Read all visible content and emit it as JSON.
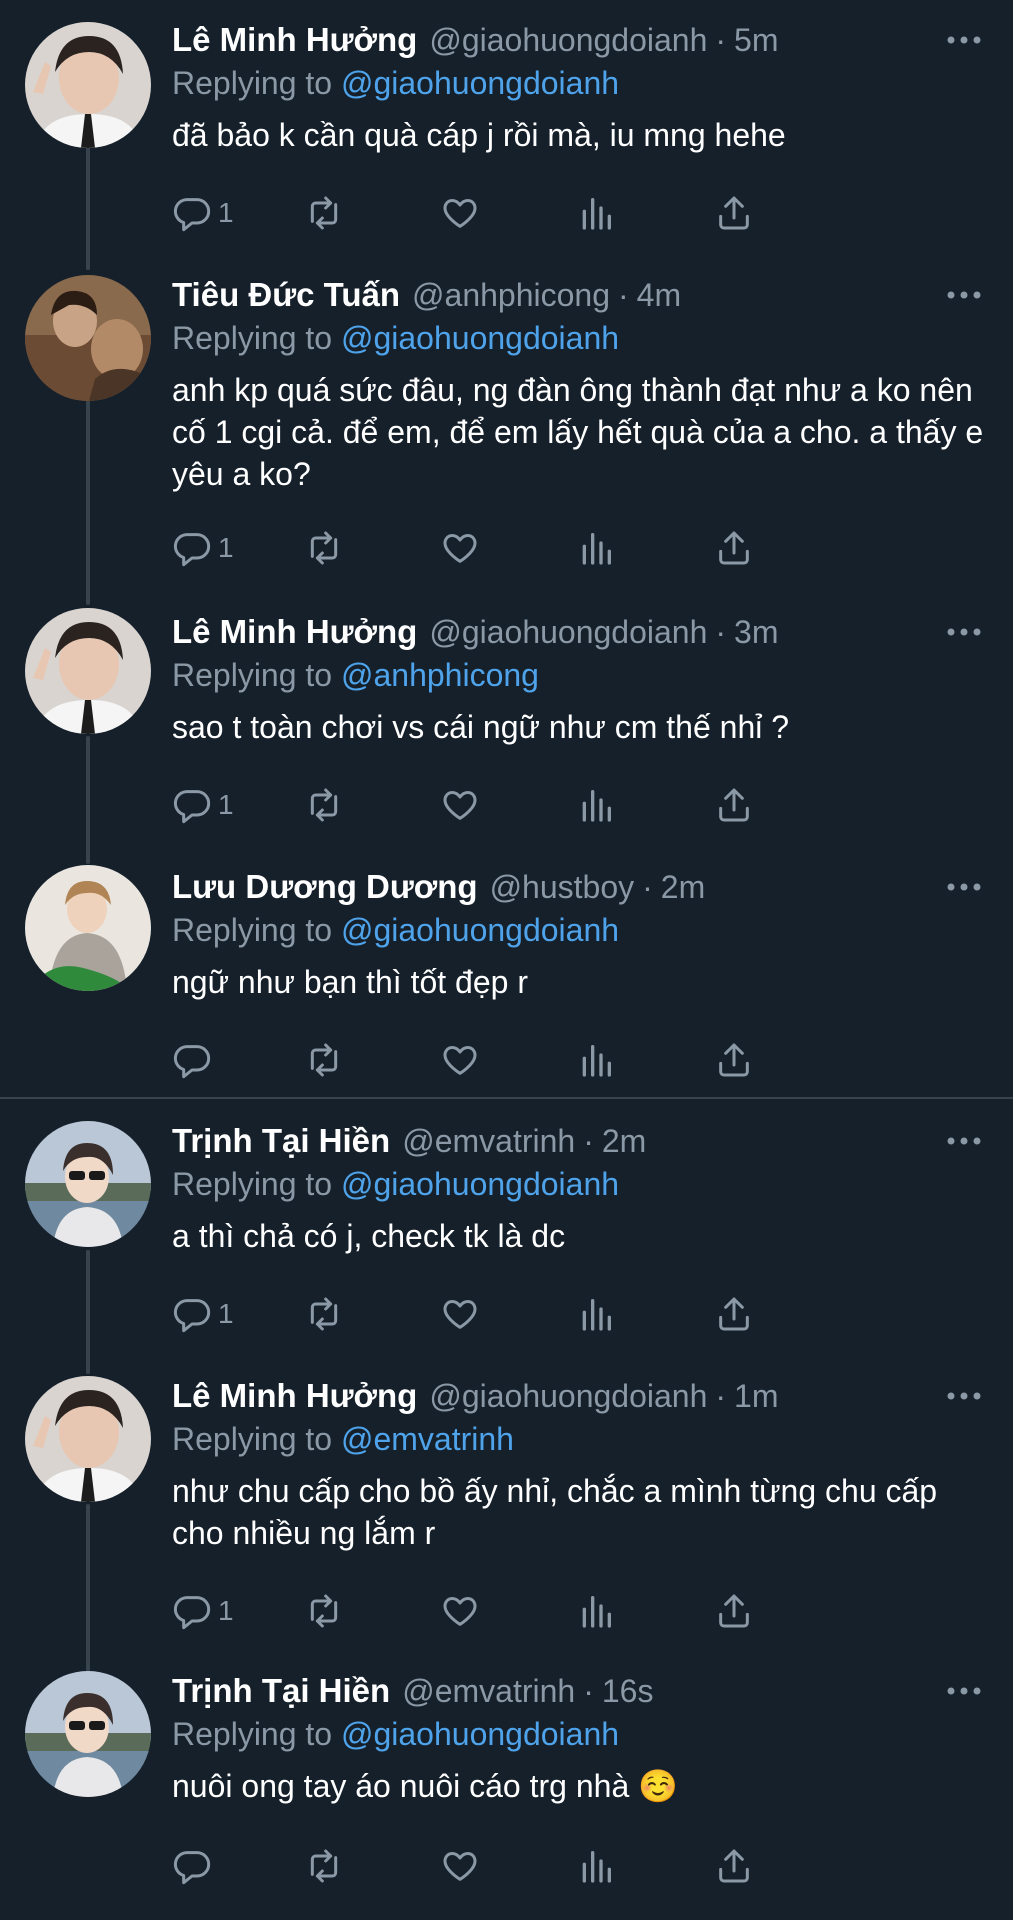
{
  "tweets": [
    {
      "name": "Lê Minh Hưởng",
      "handle": "@giaohuongdoianh",
      "dot": "·",
      "time": "5m",
      "reply_prefix": "Replying to",
      "reply_to": "@giaohuongdoianh",
      "text": "đã bảo k cần quà cáp j rồi mà, iu mng hehe",
      "reply_count": "1",
      "avatar": "user-avatar-le-minh-huong"
    },
    {
      "name": "Tiêu Đức Tuấn",
      "handle": "@anhphicong",
      "dot": "·",
      "time": "4m",
      "reply_prefix": "Replying to",
      "reply_to": "@giaohuongdoianh",
      "text": "anh kp quá sức đâu, ng đàn ông thành đạt như a ko nên cố 1 cgi cả. để em, để em lấy hết quà của a cho. a thấy e yêu a ko?",
      "reply_count": "1",
      "avatar": "user-avatar-tieu-duc-tuan"
    },
    {
      "name": "Lê Minh Hưởng",
      "handle": "@giaohuongdoianh",
      "dot": "·",
      "time": "3m",
      "reply_prefix": "Replying to",
      "reply_to": "@anhphicong",
      "text": "sao t toàn chơi vs cái ngữ như cm thế nhỉ ?",
      "reply_count": "1",
      "avatar": "user-avatar-le-minh-huong"
    },
    {
      "name": "Lưu Dương Dương",
      "handle": "@hustboy",
      "dot": "·",
      "time": "2m",
      "reply_prefix": "Replying to",
      "reply_to": "@giaohuongdoianh",
      "text": "ngữ như bạn thì tốt đẹp r",
      "reply_count": "",
      "avatar": "user-avatar-luu-duong-duong"
    },
    {
      "name": "Trịnh Tại Hiền",
      "handle": "@emvatrinh",
      "dot": "·",
      "time": "2m",
      "reply_prefix": "Replying to",
      "reply_to": "@giaohuongdoianh",
      "text": "a thì chả có j, check tk là dc",
      "reply_count": "1",
      "avatar": "user-avatar-trinh-tai-hien"
    },
    {
      "name": "Lê Minh Hưởng",
      "handle": "@giaohuongdoianh",
      "dot": "·",
      "time": "1m",
      "reply_prefix": "Replying to",
      "reply_to": "@emvatrinh",
      "text": "như chu cấp cho bồ ấy nhỉ, chắc a mình từng chu cấp cho nhiều ng lắm r",
      "reply_count": "1",
      "avatar": "user-avatar-le-minh-huong"
    },
    {
      "name": "Trịnh Tại Hiền",
      "handle": "@emvatrinh",
      "dot": "·",
      "time": "16s",
      "reply_prefix": "Replying to",
      "reply_to": "@giaohuongdoianh",
      "text": "nuôi ong tay áo nuôi cáo trg nhà ☺️",
      "reply_count": "",
      "avatar": "user-avatar-trinh-tai-hien"
    }
  ],
  "icons": {
    "more": "more-options-icon",
    "reply": "reply-icon",
    "retweet": "retweet-icon",
    "like": "like-icon",
    "analytics": "analytics-icon",
    "share": "share-icon"
  },
  "colors": {
    "background": "#15202b",
    "secondary_text": "#8b98a5",
    "mention": "#4fa3ea",
    "thread_line": "#38444d"
  }
}
